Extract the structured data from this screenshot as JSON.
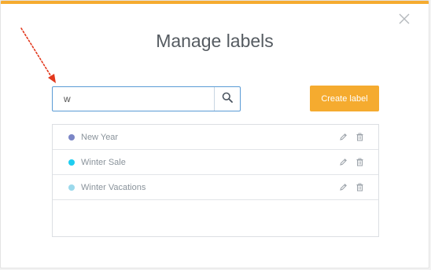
{
  "modal": {
    "title": "Manage labels",
    "close_icon": "close-icon",
    "accent_color": "#f5ab2f"
  },
  "search": {
    "value": "w",
    "placeholder": "",
    "icon": "search-icon"
  },
  "create_button": {
    "label": "Create label"
  },
  "labels": [
    {
      "name": "New Year",
      "color": "#7b86c6"
    },
    {
      "name": "Winter Sale",
      "color": "#1ecdf0"
    },
    {
      "name": "Winter Vacations",
      "color": "#9bd9ec"
    }
  ],
  "row_actions": {
    "edit_icon": "pencil-icon",
    "delete_icon": "trash-icon"
  },
  "annotation": {
    "arrow_color": "#e2381d"
  }
}
